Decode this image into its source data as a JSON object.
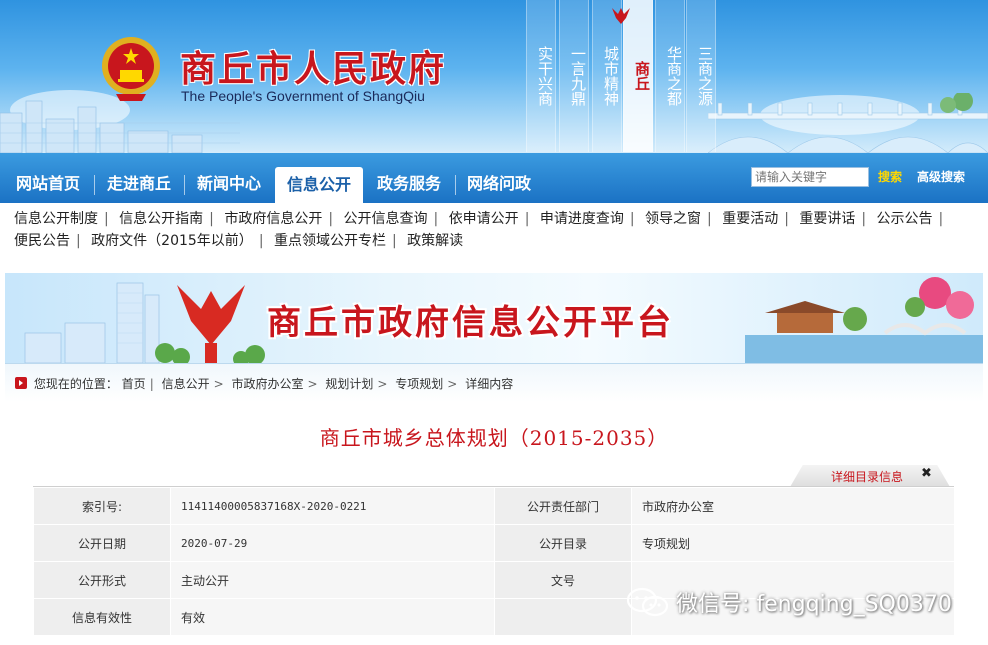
{
  "header": {
    "title": "商丘市人民政府",
    "subtitle": "The People's Government of ShangQiu",
    "strips": [
      {
        "text": "实干兴商",
        "active": false
      },
      {
        "text": "一言九鼎",
        "active": false
      },
      {
        "text": "城市精神",
        "active": false
      },
      {
        "text": "商丘",
        "active": true
      },
      {
        "text": "华商之都",
        "active": false
      },
      {
        "text": "三商之源",
        "active": false
      }
    ]
  },
  "nav": {
    "items": [
      "网站首页",
      "走进商丘",
      "新闻中心",
      "信息公开",
      "政务服务",
      "网络问政"
    ],
    "active_index": 3,
    "search": {
      "placeholder": "请输入关键字",
      "button": "搜索",
      "advanced": "高级搜索"
    }
  },
  "subnav": {
    "row1": [
      "信息公开制度",
      "信息公开指南",
      "市政府信息公开",
      "公开信息查询",
      "依申请公开",
      "申请进度查询",
      "领导之窗",
      "重要活动",
      "重要讲话",
      "公示公告"
    ],
    "row2": [
      "便民公告",
      "政府文件（2015年以前）",
      "重点领域公开专栏",
      "政策解读"
    ]
  },
  "banner": {
    "title": "商丘市政府信息公开平台"
  },
  "breadcrumb": {
    "prefix": "您现在的位置：",
    "items": [
      "首页",
      "信息公开",
      "市政府办公室",
      "规划计划",
      "专项规划",
      "详细内容"
    ]
  },
  "document": {
    "title": "商丘市城乡总体规划（2015-2035）",
    "detail_tab": "详细目录信息",
    "close": "✖"
  },
  "info": {
    "index_label": "索引号:",
    "index_value": "11411400005837168X-2020-0221",
    "dept_label": "公开责任部门",
    "dept_value": "市政府办公室",
    "date_label": "公开日期",
    "date_value": "2020-07-29",
    "catalog_label": "公开目录",
    "catalog_value": "专项规划",
    "form_label": "公开形式",
    "form_value": "主动公开",
    "docno_label": "文号",
    "docno_value": "",
    "validity_label": "信息有效性",
    "validity_value": "有效"
  },
  "watermark": "微信号: fengqing_SQ0370",
  "colors": {
    "brand_red": "#c8161d",
    "nav_blue": "#1b72c4",
    "link_dark": "#222222"
  }
}
